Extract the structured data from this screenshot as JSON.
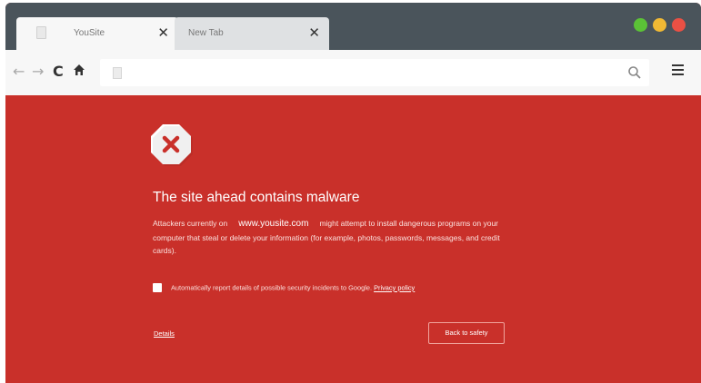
{
  "tabs": [
    {
      "title": "YouSite",
      "close": "✕"
    },
    {
      "title": "New Tab",
      "close": "✕"
    }
  ],
  "window_controls": {
    "green": "#5bc236",
    "yellow": "#f1b934",
    "red": "#ea5044"
  },
  "toolbar": {
    "back_icon": "←",
    "forward_icon": "→",
    "reload_icon": "C",
    "home_icon": "⌂",
    "icons": [
      "arrow-left-icon",
      "arrow-right-icon",
      "reload-icon",
      "home-icon",
      "page-icon",
      "search-icon",
      "menu-icon"
    ]
  },
  "address_bar": {
    "value": ""
  },
  "warning": {
    "accent": "#c9302a",
    "headline": "The site ahead contains malware",
    "desc_prefix": "Attackers currently on",
    "domain": "www.yousite.com",
    "desc_suffix": "might attempt to install dangerous programs on your computer that steal or delete your information (for example, photos, passwords, messages, and credit cards).",
    "report_label": "Automatically report details of possible security incidents to Google.",
    "privacy_link": "Privacy policy",
    "details_link": "Details",
    "back_button": "Back to safety"
  }
}
